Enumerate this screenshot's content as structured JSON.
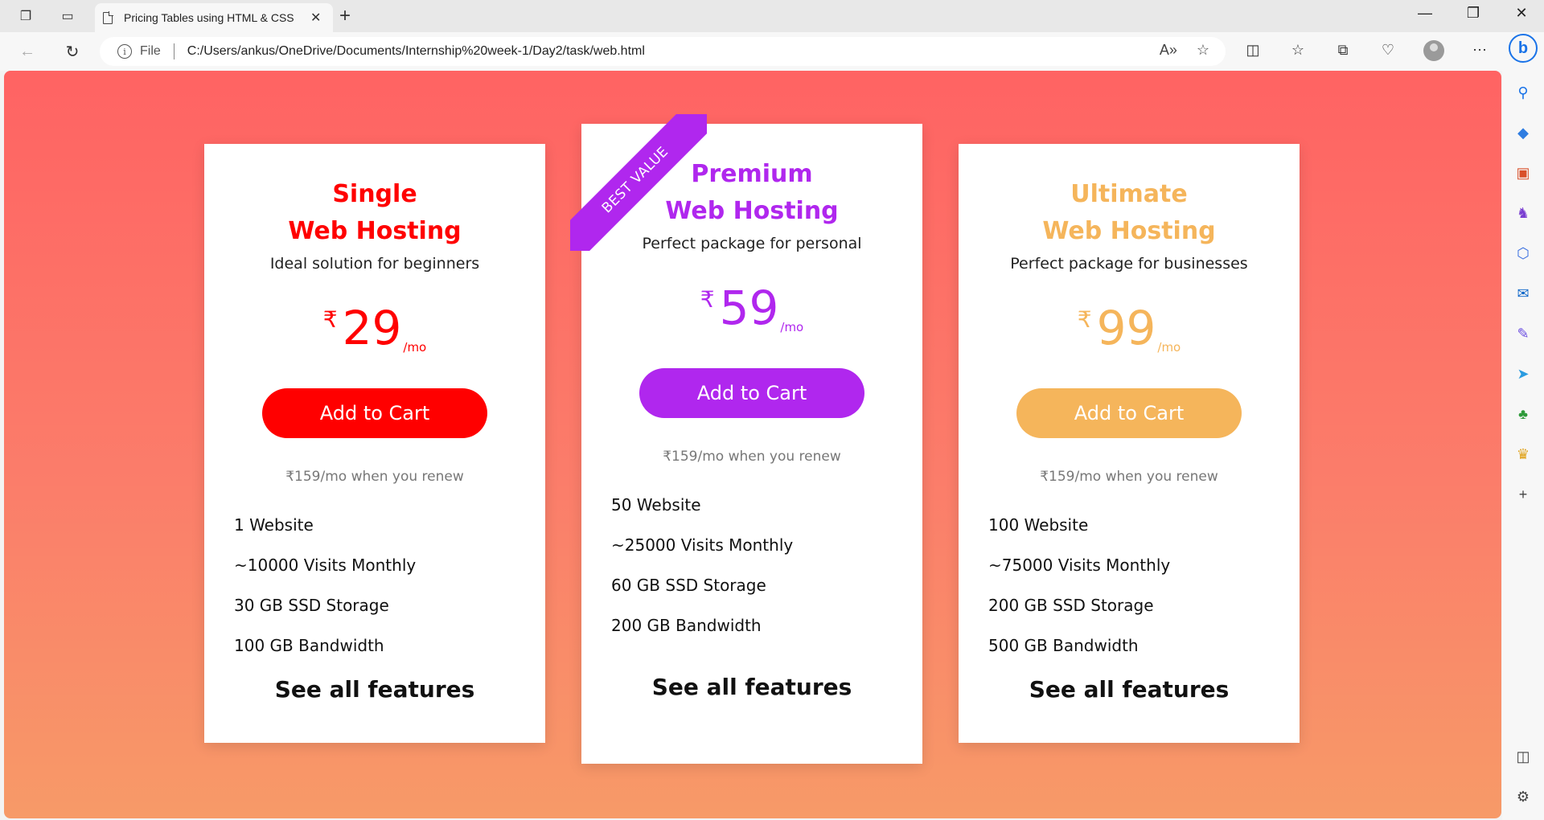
{
  "browser": {
    "tab_title": "Pricing Tables using HTML & CSS",
    "file_label": "File",
    "url": "C:/Users/ankus/OneDrive/Documents/Internship%20week-1/Day2/task/web.html"
  },
  "colors": {
    "single": "#ff0000",
    "premium": "#b027ee",
    "ultimate": "#f5b55b"
  },
  "plans": [
    {
      "name_line1": "Single",
      "name_line2": "Web Hosting",
      "subtitle": "Ideal solution for beginners",
      "currency": "₹",
      "price": "29",
      "period": "/mo",
      "button": "Add to Cart",
      "renew": "₹159/mo when you renew",
      "features": [
        "1 Website",
        "~10000 Visits Monthly",
        "30 GB SSD Storage",
        "100 GB Bandwidth"
      ],
      "more": "See all features"
    },
    {
      "ribbon": "BEST VALUE",
      "name_line1": "Premium",
      "name_line2": "Web Hosting",
      "subtitle": "Perfect package for personal",
      "currency": "₹",
      "price": "59",
      "period": "/mo",
      "button": "Add to Cart",
      "renew": "₹159/mo when you renew",
      "features": [
        "50 Website",
        "~25000 Visits Monthly",
        "60 GB SSD Storage",
        "200 GB Bandwidth"
      ],
      "more": "See all features"
    },
    {
      "name_line1": "Ultimate",
      "name_line2": "Web Hosting",
      "subtitle": "Perfect package for businesses",
      "currency": "₹",
      "price": "99",
      "period": "/mo",
      "button": "Add to Cart",
      "renew": "₹159/mo when you renew",
      "features": [
        "100 Website",
        "~75000 Visits Monthly",
        "200 GB SSD Storage",
        "500 GB Bandwidth"
      ],
      "more": "See all features"
    }
  ]
}
